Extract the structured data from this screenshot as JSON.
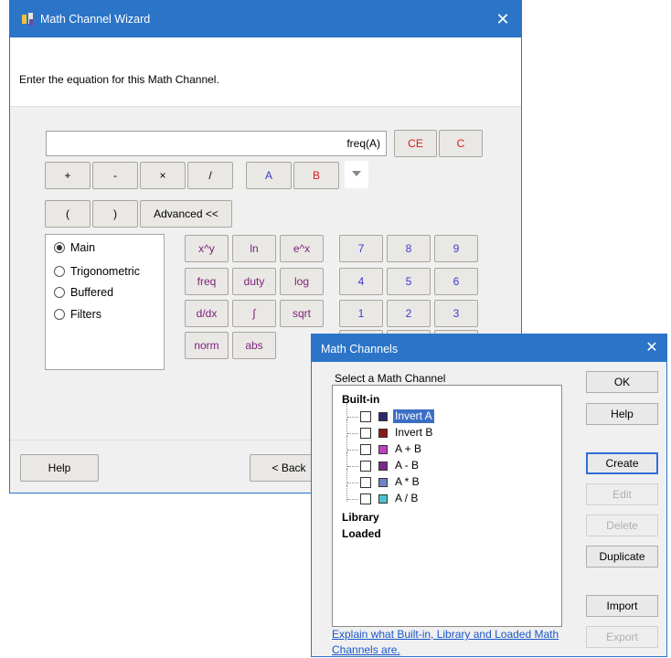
{
  "wizard": {
    "title": "Math Channel Wizard",
    "close_glyph": "✕",
    "prompt": "Enter the equation for this Math Channel.",
    "equation_value": "freq(A)",
    "clear_entry": "CE",
    "clear": "C",
    "operators": [
      "+",
      "-",
      "×",
      "/"
    ],
    "channels": [
      "A",
      "B"
    ],
    "paren_open": "(",
    "paren_close": ")",
    "advanced": "Advanced <<",
    "categories": [
      {
        "label": "Main",
        "selected": true
      },
      {
        "label": "Trigonometric",
        "selected": false
      },
      {
        "label": "Buffered",
        "selected": false
      },
      {
        "label": "Filters",
        "selected": false
      }
    ],
    "functions": [
      "x^y",
      "ln",
      "e^x",
      "freq",
      "duty",
      "log",
      "d/dx",
      "∫",
      "sqrt",
      "norm",
      "abs"
    ],
    "digits": [
      "7",
      "8",
      "9",
      "4",
      "5",
      "6",
      "1",
      "2",
      "3"
    ],
    "help": "Help",
    "back": "< Back"
  },
  "channels_dialog": {
    "title": "Math Channels",
    "close_glyph": "✕",
    "select_label": "Select a Math Channel",
    "groups": [
      "Built-in",
      "Library",
      "Loaded"
    ],
    "items": [
      {
        "name": "Invert A",
        "color": "#2a2a6e",
        "selected": true
      },
      {
        "name": "Invert B",
        "color": "#8a1a1a",
        "selected": false
      },
      {
        "name": "A + B",
        "color": "#c040c0",
        "selected": false
      },
      {
        "name": "A - B",
        "color": "#7a2a8a",
        "selected": false
      },
      {
        "name": "A * B",
        "color": "#6b86c4",
        "selected": false
      },
      {
        "name": "A / B",
        "color": "#4fc4cf",
        "selected": false
      }
    ],
    "link_text": "Explain what Built-in, Library and Loaded Math Channels are.",
    "buttons": {
      "ok": "OK",
      "help": "Help",
      "create": "Create",
      "edit": "Edit",
      "delete": "Delete",
      "duplicate": "Duplicate",
      "import": "Import",
      "export": "Export"
    }
  },
  "colors": {
    "titlebar": "#2b74c8",
    "red_text": "#d42020",
    "blue_text": "#3b3bd0",
    "function_text": "#7a1f7a",
    "link": "#1a56c9"
  }
}
